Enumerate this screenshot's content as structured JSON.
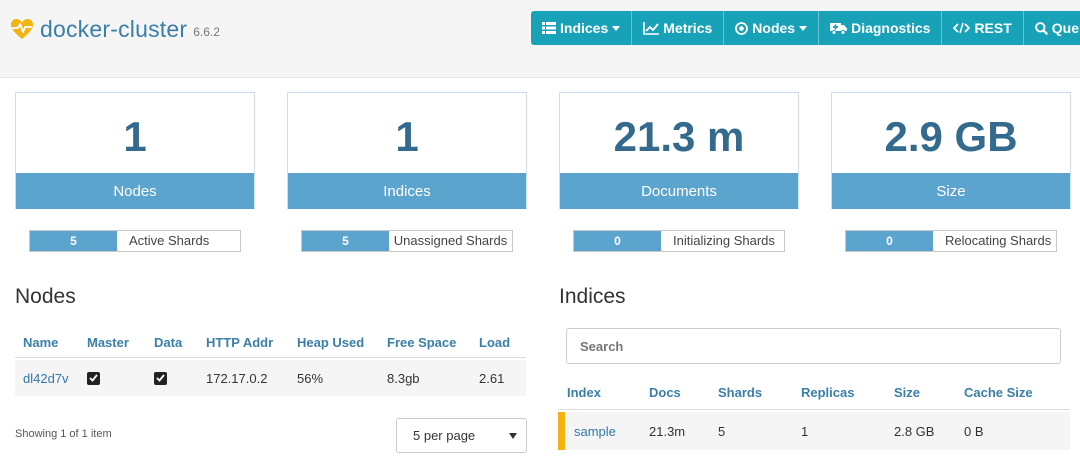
{
  "app": {
    "title": "docker-cluster",
    "version": "6.6.2",
    "heart_color": "#f3b412"
  },
  "nav": {
    "indices": "Indices",
    "metrics": "Metrics",
    "nodes": "Nodes",
    "diagnostics": "Diagnostics",
    "rest": "REST",
    "query": "Query",
    "color": "#17a2b8"
  },
  "stats": {
    "nodes": {
      "value": "1",
      "label": "Nodes"
    },
    "indices": {
      "value": "1",
      "label": "Indices"
    },
    "documents": {
      "value": "21.3 m",
      "label": "Documents"
    },
    "size": {
      "value": "2.9 GB",
      "label": "Size"
    }
  },
  "shards": {
    "active": {
      "value": "5",
      "label": "Active Shards"
    },
    "unassigned": {
      "value": "5",
      "label": "Unassigned Shards"
    },
    "initializing": {
      "value": "0",
      "label": "Initializing Shards"
    },
    "relocating": {
      "value": "0",
      "label": "Relocating Shards"
    }
  },
  "nodes_section": {
    "title": "Nodes",
    "columns": [
      "Name",
      "Master",
      "Data",
      "HTTP Addr",
      "Heap Used",
      "Free Space",
      "Load"
    ],
    "rows": [
      {
        "name": "dl42d7v",
        "master": true,
        "data": true,
        "http_addr": "172.17.0.2",
        "heap_used": "56%",
        "free_space": "8.3gb",
        "load": "2.61"
      }
    ],
    "showing": "Showing 1 of 1 item",
    "per_page": "5 per page"
  },
  "indices_section": {
    "title": "Indices",
    "search_placeholder": "Search",
    "columns": [
      "Index",
      "Docs",
      "Shards",
      "Replicas",
      "Size",
      "Cache Size"
    ],
    "rows": [
      {
        "index": "sample",
        "docs": "21.3m",
        "shards": "5",
        "replicas": "1",
        "size": "2.8 GB",
        "cache_size": "0 B",
        "status_color": "#f3b412"
      }
    ]
  }
}
